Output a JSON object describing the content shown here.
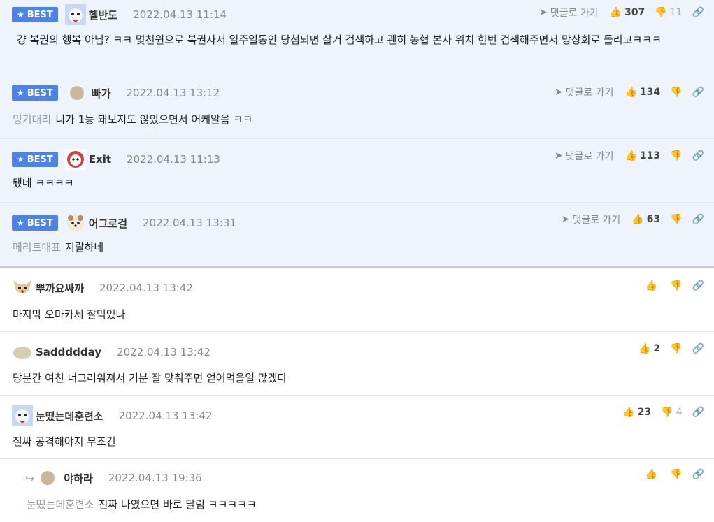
{
  "best_comments": [
    {
      "badge": "BEST",
      "nick": "헬반도",
      "date": "2022.04.13 11:14",
      "reply_label": "댓글로 가기",
      "likes": "307",
      "dislikes": "11",
      "mention": "",
      "text": "걍 복권의 행복 아님? ㅋㅋ 몇천원으로 복권사서 일주일동안 당첨되면 살거 검색하고 괜히 농협 본사 위치 한번 검색해주면서 망상회로 돌리고ㅋㅋㅋ"
    },
    {
      "badge": "BEST",
      "nick": "빠가",
      "date": "2022.04.13 13:12",
      "reply_label": "댓글로 가기",
      "likes": "134",
      "dislikes": "",
      "mention": "멍기대리",
      "text": "니가 1등 돼보지도 않았으면서 어케알음 ㅋㅋ"
    },
    {
      "badge": "BEST",
      "nick": "Exit",
      "date": "2022.04.13 11:13",
      "reply_label": "댓글로 가기",
      "likes": "113",
      "dislikes": "",
      "mention": "",
      "text": "됐네 ㅋㅋㅋㅋ"
    },
    {
      "badge": "BEST",
      "nick": "어그로걸",
      "date": "2022.04.13 13:31",
      "reply_label": "댓글로 가기",
      "likes": "63",
      "dislikes": "",
      "mention": "메리트대표",
      "text": "지랄하네"
    }
  ],
  "comments": [
    {
      "nick": "뿌까요싸까",
      "date": "2022.04.13 13:42",
      "likes": "",
      "dislikes": "",
      "mention": "",
      "text": "마지막 오마카세 잘먹었나"
    },
    {
      "nick": "Saddddday",
      "date": "2022.04.13 13:42",
      "likes": "2",
      "dislikes": "",
      "mention": "",
      "text": "당분간 여친 너그러워져서 기분 잘 맞춰주면 얻어먹을일 많겠다"
    },
    {
      "nick": "눈떴는데훈련소",
      "date": "2022.04.13 13:42",
      "likes": "23",
      "dislikes": "4",
      "mention": "",
      "text": "질싸 공격해야지 무조건"
    },
    {
      "nick": "야하라",
      "date": "2022.04.13 19:36",
      "likes": "",
      "dislikes": "",
      "mention": "눈떴는데훈련소",
      "text": "진짜 나였으면 바로 달림 ㅋㅋㅋㅋㅋ"
    }
  ],
  "colors": {
    "best_bg": "#eef3fc",
    "badge": "#4b84e6"
  }
}
